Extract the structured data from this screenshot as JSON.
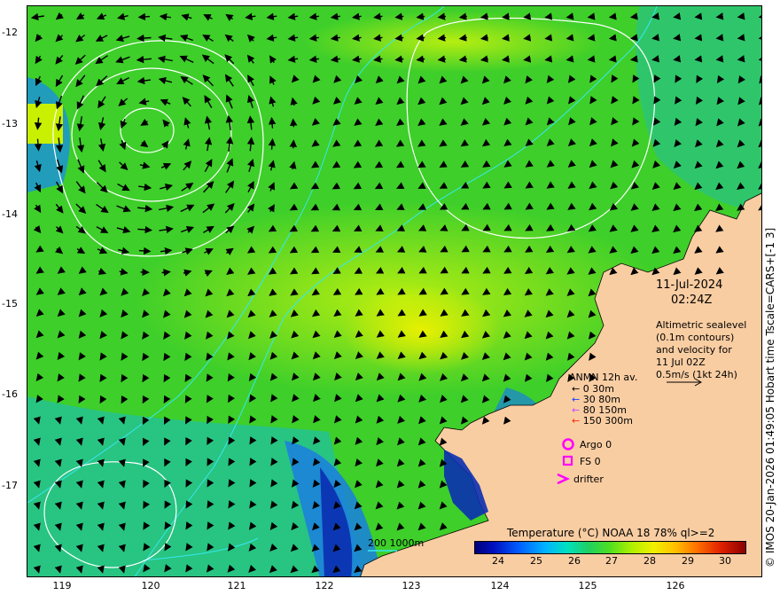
{
  "map": {
    "date": "11-Jul-2024",
    "time": "02:24Z",
    "altimetry_note": [
      "Altimetric sealevel",
      "(0.1m contours)",
      "and velocity for",
      "11 Jul 02Z",
      "0.5m/s (1kt 24h)"
    ],
    "credit": "© IMOS 20-Jan-2026 01:49:05 Hobart time Tscale=CARS+[-1 3]",
    "y_ticks": [
      "-12",
      "-13",
      "-14",
      "-15",
      "-16",
      "-17"
    ],
    "x_ticks": [
      "119",
      "120",
      "121",
      "122",
      "123",
      "124",
      "125",
      "126"
    ],
    "isobath_label": "200  1000m",
    "legend": {
      "title": "ANMN 12h av.",
      "items": [
        {
          "label": "0 30m",
          "color": "#000000"
        },
        {
          "label": "30 80m",
          "color": "#1a3cff"
        },
        {
          "label": "80 150m",
          "color": "#cc44ff"
        },
        {
          "label": "150 300m",
          "color": "#ff2a00"
        }
      ],
      "argo": "Argo 0",
      "fs": "FS 0",
      "drifter": "drifter",
      "marker_color": "#ff00ff"
    },
    "colorbar": {
      "title": "Temperature (°C) NOAA 18 78% ql>=2",
      "ticks": [
        "24",
        "25",
        "26",
        "27",
        "28",
        "29",
        "30"
      ]
    },
    "colors": {
      "land": "#f9cda2",
      "ocean_green": "#3ecf2a",
      "ocean_yellow": "#c8f000",
      "ocean_blue": "#1060e8",
      "contour_sealevel": "#ffffff",
      "contour_isobath": "#36e8f0"
    }
  }
}
